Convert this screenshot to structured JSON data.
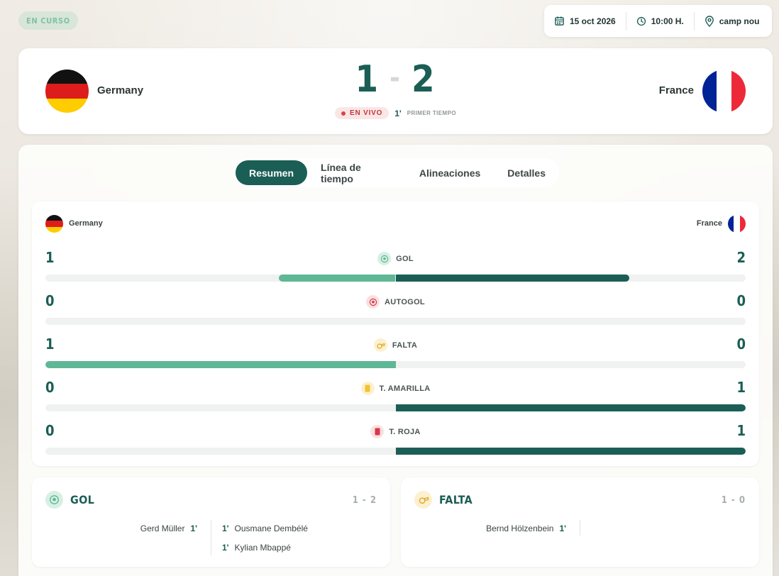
{
  "status": {
    "label": "EN CURSO"
  },
  "meta": {
    "date": "15 oct 2026",
    "time": "10:00 H.",
    "venue": "camp nou"
  },
  "match": {
    "home": {
      "name": "Germany",
      "score": "1"
    },
    "away": {
      "name": "France",
      "score": "2"
    },
    "live_label": "EN VIVO",
    "minute": "1'",
    "period": "PRIMER TIEMPO"
  },
  "tabs": [
    {
      "label": "Resumen",
      "active": true
    },
    {
      "label": "Línea de tiempo",
      "active": false
    },
    {
      "label": "Alineaciones",
      "active": false
    },
    {
      "label": "Detalles",
      "active": false
    }
  ],
  "stats": {
    "home_name": "Germany",
    "away_name": "France",
    "rows": [
      {
        "label": "GOL",
        "icon": "ball-icon",
        "home": "1",
        "away": "2",
        "home_share": 0.333,
        "away_share": 0.667
      },
      {
        "label": "AUTOGOL",
        "icon": "own-goal-ball-icon",
        "home": "0",
        "away": "0",
        "home_share": 0,
        "away_share": 0
      },
      {
        "label": "FALTA",
        "icon": "whistle-icon",
        "home": "1",
        "away": "0",
        "home_share": 1,
        "away_share": 0
      },
      {
        "label": "T. AMARILLA",
        "icon": "yellow-card-icon",
        "home": "0",
        "away": "1",
        "home_share": 0,
        "away_share": 1
      },
      {
        "label": "T. ROJA",
        "icon": "red-card-icon",
        "home": "0",
        "away": "1",
        "home_share": 0,
        "away_share": 1
      }
    ]
  },
  "events": {
    "goals": {
      "title": "GOL",
      "score": "1 - 2",
      "home": [
        {
          "player": "Gerd Müller",
          "minute": "1'"
        }
      ],
      "away": [
        {
          "player": "Ousmane Dembélé",
          "minute": "1'"
        },
        {
          "player": "Kylian Mbappé",
          "minute": "1'"
        }
      ]
    },
    "fouls": {
      "title": "FALTA",
      "score": "1 - 0",
      "home": [
        {
          "player": "Bernd Hölzenbein",
          "minute": "1'"
        }
      ],
      "away": []
    }
  },
  "colors": {
    "primary": "#1b5e55",
    "home_bar": "#5fb795",
    "live_red": "#c0393b",
    "yellow_card": "#f2c230",
    "red_card": "#d9364a"
  }
}
